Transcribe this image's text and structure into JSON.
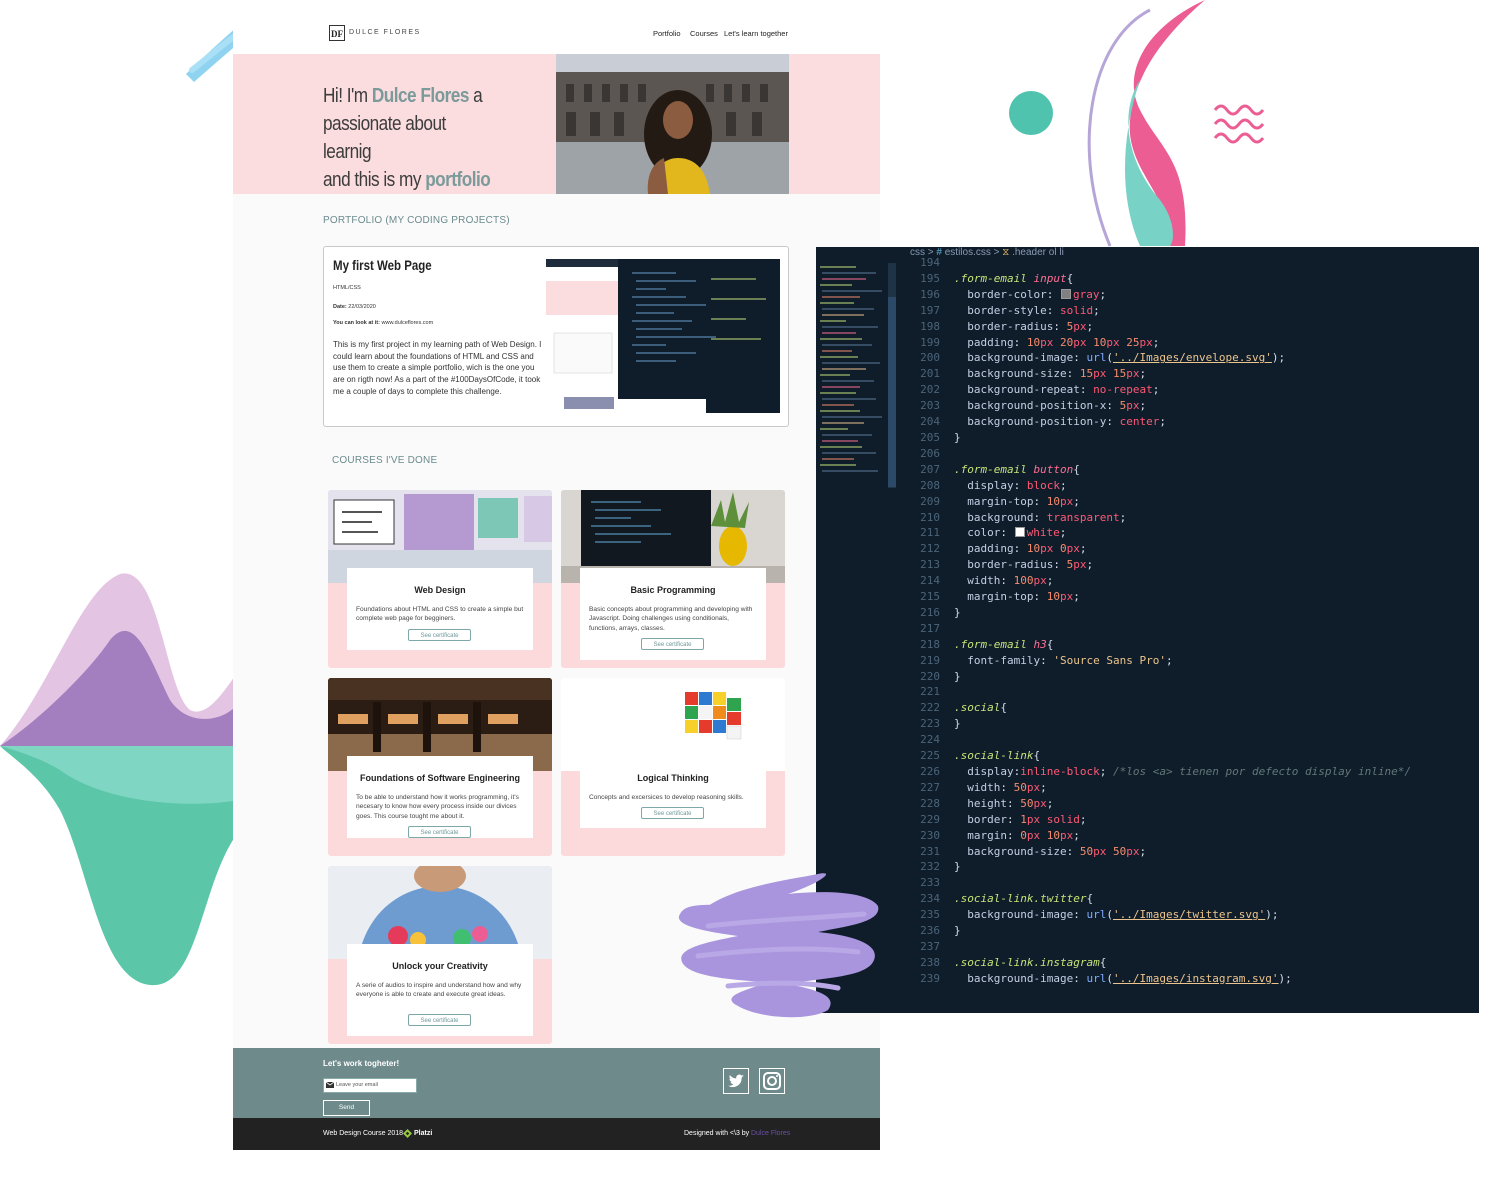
{
  "site": {
    "logo_mark": "DF",
    "logo_name": "DULCE FLORES",
    "nav": [
      "Portfolio",
      "Courses",
      "Let's learn together"
    ],
    "hero": {
      "line1_prefix": "Hi! I'm ",
      "name": "Dulce Flores",
      "line1_suffix": " a",
      "line2": "passionate about learnig",
      "line3_prefix": "and this is my ",
      "portfolio_word": "portfolio"
    },
    "portfolio_section_title": "PORTFOLIO (MY CODING PROJECTS)",
    "project": {
      "title": "My first Web Page",
      "tech": "HTML/CSS",
      "date_label": "Date:",
      "date": "22/03/2020",
      "link_label": "You can look at it:",
      "link": "www.dulceflores.com",
      "description": "This is my first project in my learning path of Web Design. I could learn about the foundations of HTML and CSS and use them to create a simple portfolio, wich is the one you are on rigth now! As a part of the #100DaysOfCode, it took me a couple of days to complete this challenge."
    },
    "courses_section_title": "COURSES I'VE DONE",
    "courses": [
      {
        "title": "Web Design",
        "description": "Foundations about HTML and CSS to create a simple but complete web page for begginers.",
        "button": "See certificate"
      },
      {
        "title": "Basic Programming",
        "description": "Basic concepts about programming and developing with Javascript. Doing challenges using conditionals, functions, arrays, classes.",
        "button": "See certificate"
      },
      {
        "title": "Foundations of Software Engineering",
        "description": "To be able to understand how it works programming, it's necesary to know how every process inside our divices goes. This course tought me about it.",
        "button": "See certificate"
      },
      {
        "title": "Logical Thinking",
        "description": "Concepts and excersices to develop reasoning skills.",
        "button": "See certificate"
      },
      {
        "title": "Unlock your Creativity",
        "description": "A serie of audios to inspire and understand how and why everyone is able to create and execute great ideas.",
        "button": "See certificate"
      }
    ],
    "footer": {
      "title": "Let's work togheter!",
      "email_placeholder": "Leave your email",
      "send": "Send",
      "course_credit": "Web Design Course 2018",
      "platzi": "Platzi",
      "designed_by": "Designed with <\\3 by",
      "designer": "Dulce Flores"
    }
  },
  "editor": {
    "breadcrumb": [
      "css",
      "estilos.css",
      ".header ol li"
    ],
    "lines": [
      {
        "n": "194",
        "t": ""
      },
      {
        "n": "195",
        "t": ".form-email input{"
      },
      {
        "n": "196",
        "t": "  border-color: gray;"
      },
      {
        "n": "197",
        "t": "  border-style: solid;"
      },
      {
        "n": "198",
        "t": "  border-radius: 5px;"
      },
      {
        "n": "199",
        "t": "  padding: 10px 20px 10px 25px;"
      },
      {
        "n": "200",
        "t": "  background-image: url('../Images/envelope.svg');"
      },
      {
        "n": "201",
        "t": "  background-size: 15px 15px;"
      },
      {
        "n": "202",
        "t": "  background-repeat: no-repeat;"
      },
      {
        "n": "203",
        "t": "  background-position-x: 5px;"
      },
      {
        "n": "204",
        "t": "  background-position-y: center;"
      },
      {
        "n": "205",
        "t": "}"
      },
      {
        "n": "206",
        "t": ""
      },
      {
        "n": "207",
        "t": ".form-email button{"
      },
      {
        "n": "208",
        "t": "  display: block;"
      },
      {
        "n": "209",
        "t": "  margin-top: 10px;"
      },
      {
        "n": "210",
        "t": "  background: transparent;"
      },
      {
        "n": "211",
        "t": "  color: white;"
      },
      {
        "n": "212",
        "t": "  padding: 10px 0px;"
      },
      {
        "n": "213",
        "t": "  border-radius: 5px;"
      },
      {
        "n": "214",
        "t": "  width: 100px;"
      },
      {
        "n": "215",
        "t": "  margin-top: 10px;"
      },
      {
        "n": "216",
        "t": "}"
      },
      {
        "n": "217",
        "t": ""
      },
      {
        "n": "218",
        "t": ".form-email h3{"
      },
      {
        "n": "219",
        "t": "  font-family: 'Source Sans Pro';"
      },
      {
        "n": "220",
        "t": "}"
      },
      {
        "n": "221",
        "t": ""
      },
      {
        "n": "222",
        "t": ".social{"
      },
      {
        "n": "223",
        "t": "}"
      },
      {
        "n": "224",
        "t": ""
      },
      {
        "n": "225",
        "t": ".social-link{"
      },
      {
        "n": "226",
        "t": "  display:inline-block; /*los <a> tienen por defecto display inline*/"
      },
      {
        "n": "227",
        "t": "  width: 50px;"
      },
      {
        "n": "228",
        "t": "  height: 50px;"
      },
      {
        "n": "229",
        "t": "  border: 1px solid;"
      },
      {
        "n": "230",
        "t": "  margin: 0px 10px;"
      },
      {
        "n": "231",
        "t": "  background-size: 50px 50px;"
      },
      {
        "n": "232",
        "t": "}"
      },
      {
        "n": "233",
        "t": ""
      },
      {
        "n": "234",
        "t": ".social-link.twitter{"
      },
      {
        "n": "235",
        "t": "  background-image: url('../Images/twitter.svg');"
      },
      {
        "n": "236",
        "t": "}"
      },
      {
        "n": "237",
        "t": ""
      },
      {
        "n": "238",
        "t": ".social-link.instagram{"
      },
      {
        "n": "239",
        "t": "  background-image: url('../Images/instagram.svg');"
      }
    ]
  },
  "colors": {
    "hero_pink": "#fbdcdf",
    "teal_accent": "#7b9a9a",
    "footer_teal": "#6e8a8b",
    "editor_bg": "#0f1d2b",
    "brush_purple": "#a995dd",
    "brush_blue": "#8fd3f0",
    "magenta": "#ea5a92",
    "mint": "#6fcfbe"
  }
}
